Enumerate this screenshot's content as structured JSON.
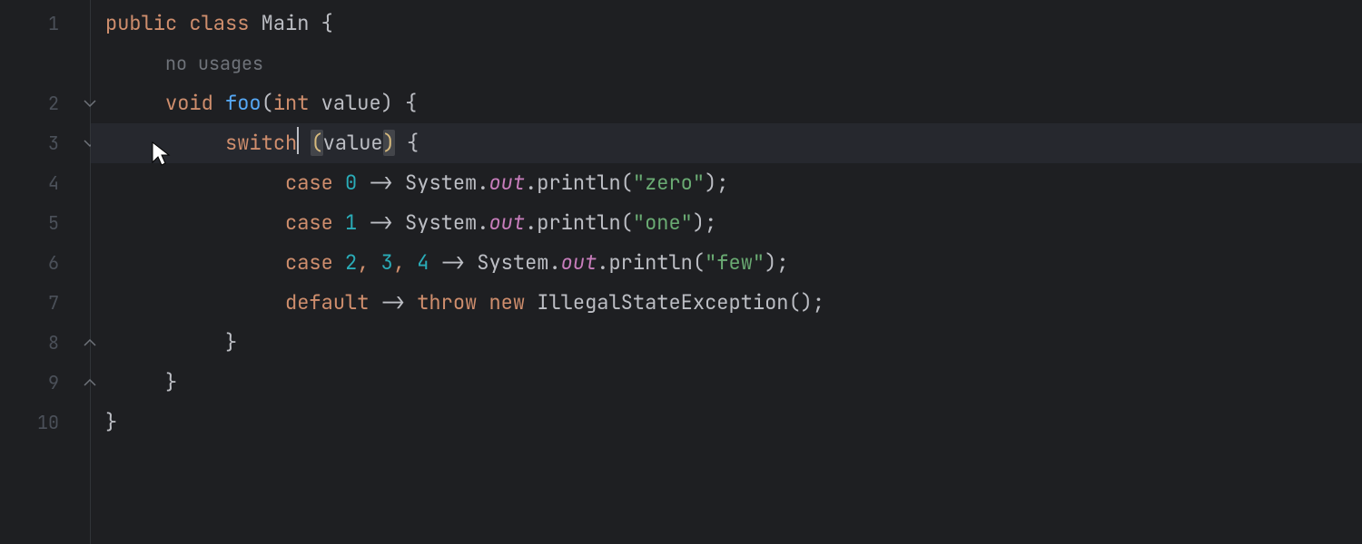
{
  "lineNumbers": [
    "1",
    "2",
    "3",
    "4",
    "5",
    "6",
    "7",
    "8",
    "9",
    "10"
  ],
  "hints": {
    "usages": "no usages"
  },
  "code": {
    "kw_public": "public",
    "kw_class": "class",
    "cls_name": "Main",
    "brace_open": "{",
    "brace_close": "}",
    "kw_void": "void",
    "fn_foo": "foo",
    "paren_open": "(",
    "paren_close": ")",
    "kw_int": "int",
    "param_value": "value",
    "kw_switch": "switch",
    "kw_case": "case",
    "kw_default": "default",
    "kw_throw": "throw",
    "kw_new": "new",
    "arrow": "->",
    "semi": ";",
    "comma": ",",
    "n0": "0",
    "n1": "1",
    "n2": "2",
    "n3": "3",
    "n4": "4",
    "sys": "System",
    "out": "out",
    "println": "println",
    "dot": ".",
    "s_zero": "\"zero\"",
    "s_one": "\"one\"",
    "s_few": "\"few\"",
    "exc": "IllegalStateException",
    "empty_args": "()"
  },
  "colors": {
    "bg": "#1e1f22",
    "hl_line": "#26282e",
    "keyword": "#CF8E6D",
    "method": "#56A8F5",
    "static_field": "#C77DBB",
    "number": "#2AACB8",
    "string": "#6AAB73"
  }
}
